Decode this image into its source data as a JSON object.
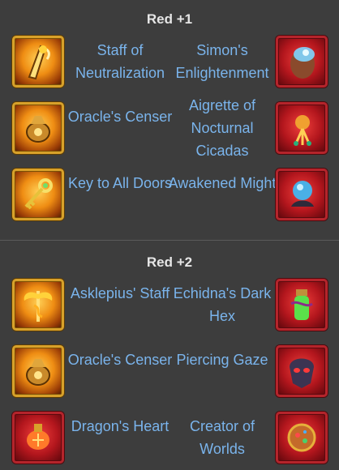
{
  "sections": [
    {
      "title": "Red +1",
      "rows": [
        {
          "left": {
            "name": "Staff of Neutralization",
            "icon": "staff-icon"
          },
          "right": {
            "name": "Simon's Enlightenment",
            "icon": "glowing-head-icon"
          }
        },
        {
          "left": {
            "name": "Oracle's Censer",
            "icon": "censer-icon"
          },
          "right": {
            "name": "Aigrette of Nocturnal Cicadas",
            "icon": "aigrette-icon"
          }
        },
        {
          "left": {
            "name": "Key to All Doors",
            "icon": "key-icon"
          },
          "right": {
            "name": "Awakened Might",
            "icon": "orb-hand-icon"
          }
        }
      ]
    },
    {
      "title": "Red +2",
      "rows": [
        {
          "left": {
            "name": "Asklepius' Staff",
            "icon": "winged-staff-icon"
          },
          "right": {
            "name": "Echidna's Dark Hex",
            "icon": "potion-icon"
          }
        },
        {
          "left": {
            "name": "Oracle's Censer",
            "icon": "censer-icon"
          },
          "right": {
            "name": "Piercing Gaze",
            "icon": "mask-icon"
          }
        },
        {
          "left": {
            "name": "Dragon's Heart",
            "icon": "lantern-icon"
          },
          "right": {
            "name": "Creator of Worlds",
            "icon": "planet-icon"
          }
        }
      ]
    }
  ],
  "colors": {
    "background": "#3d3d3d",
    "title": "#e6e6e6",
    "item_name": "#7ab4ec",
    "gold_frame": "#d8a12a",
    "red_frame": "#b5242b"
  }
}
